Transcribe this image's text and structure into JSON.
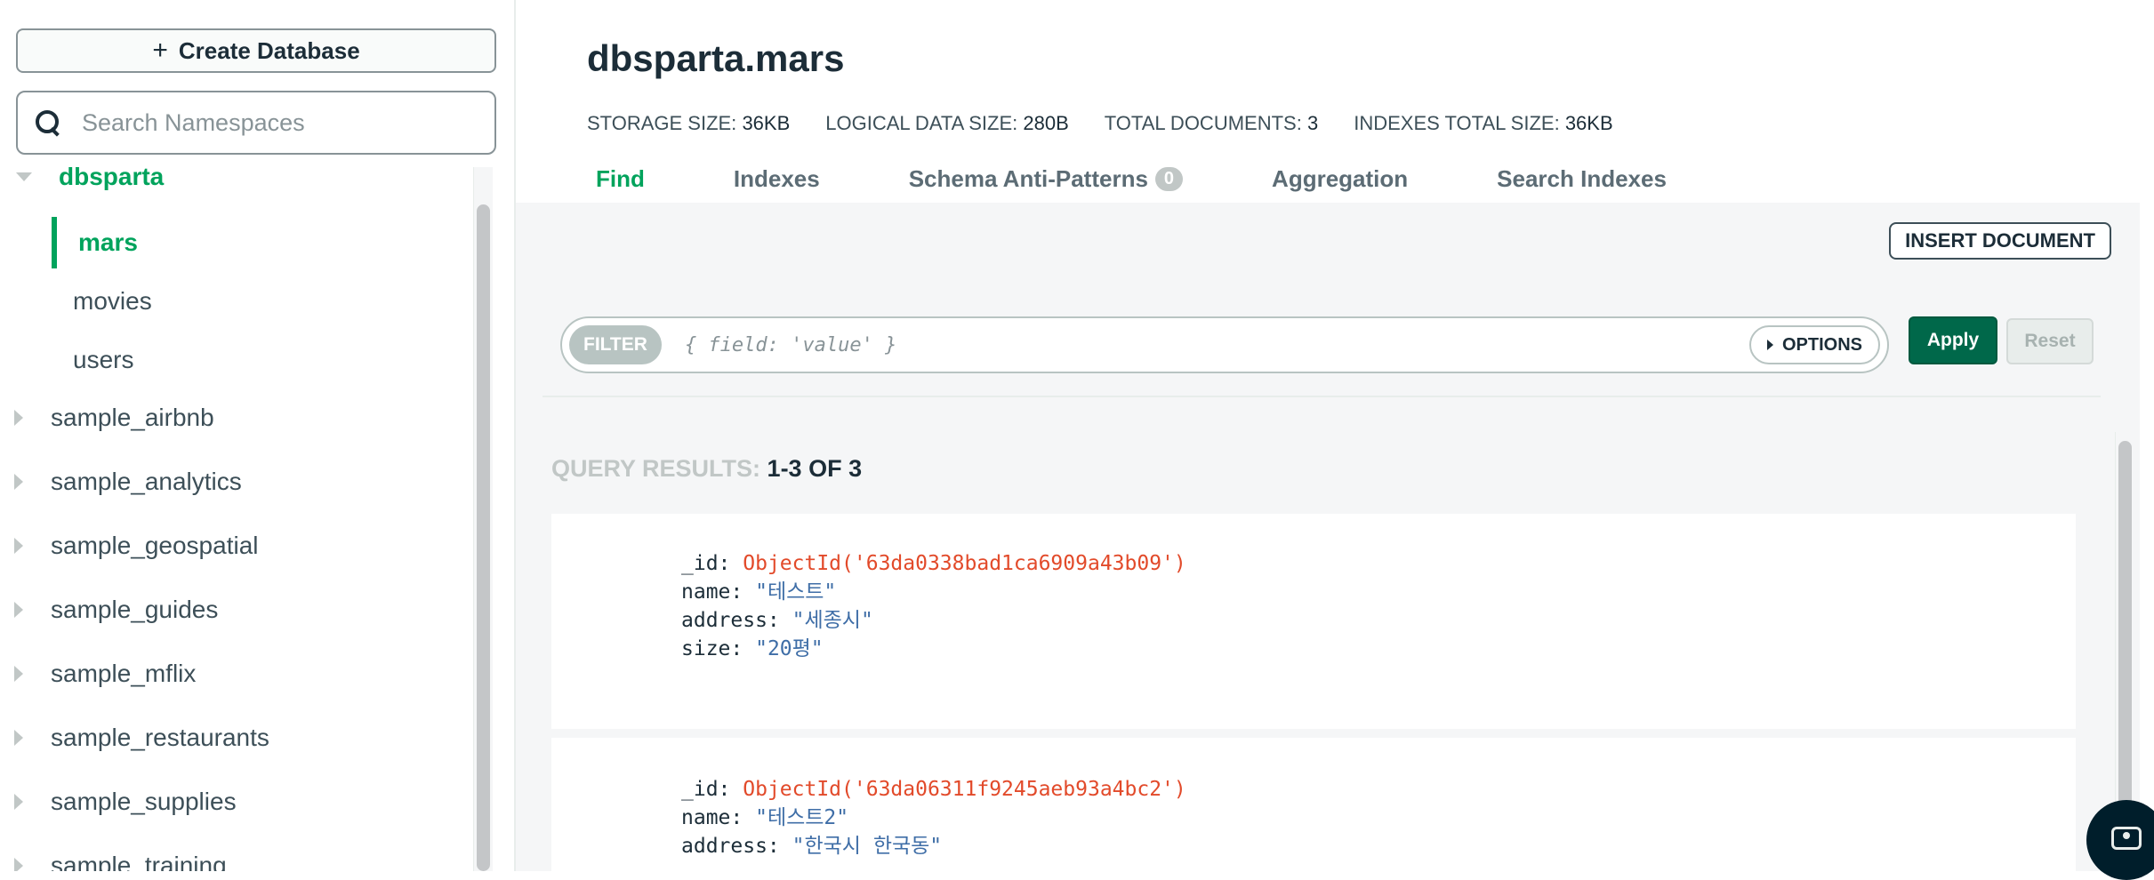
{
  "sidebar": {
    "create_database_label": "Create Database",
    "create_plus": "+",
    "search_placeholder": "Search Namespaces",
    "tree": [
      {
        "label": "dbsparta",
        "type": "database",
        "expanded": true,
        "active": true
      },
      {
        "label": "mars",
        "type": "collection",
        "active": true
      },
      {
        "label": "movies",
        "type": "collection"
      },
      {
        "label": "users",
        "type": "collection"
      },
      {
        "label": "sample_airbnb",
        "type": "database"
      },
      {
        "label": "sample_analytics",
        "type": "database"
      },
      {
        "label": "sample_geospatial",
        "type": "database"
      },
      {
        "label": "sample_guides",
        "type": "database"
      },
      {
        "label": "sample_mflix",
        "type": "database"
      },
      {
        "label": "sample_restaurants",
        "type": "database"
      },
      {
        "label": "sample_supplies",
        "type": "database"
      },
      {
        "label": "sample_training",
        "type": "database"
      }
    ]
  },
  "header": {
    "title": "dbsparta.mars",
    "stats": [
      {
        "key": "STORAGE SIZE:",
        "value": "36KB"
      },
      {
        "key": "LOGICAL DATA SIZE:",
        "value": "280B"
      },
      {
        "key": "TOTAL DOCUMENTS:",
        "value": "3"
      },
      {
        "key": "INDEXES TOTAL SIZE:",
        "value": "36KB"
      }
    ],
    "tabs": [
      {
        "label": "Find",
        "active": true
      },
      {
        "label": "Indexes"
      },
      {
        "label": "Schema Anti-Patterns",
        "badge": "0"
      },
      {
        "label": "Aggregation"
      },
      {
        "label": "Search Indexes"
      }
    ]
  },
  "toolbar": {
    "insert_document_label": "INSERT DOCUMENT",
    "filter_pill": "FILTER",
    "filter_placeholder": "{ field: 'value' }",
    "options_label": "OPTIONS",
    "apply_label": "Apply",
    "reset_label": "Reset"
  },
  "results": {
    "label": "QUERY RESULTS:",
    "count": "1-3 OF 3",
    "documents": [
      {
        "id_key": "_id:",
        "id_value": "ObjectId('63da0338bad1ca6909a43b09')",
        "name_key": "name:",
        "name_value": "\"테스트\"",
        "address_key": "address:",
        "address_value": "\"세종시\"",
        "size_key": "size:",
        "size_value": "\"20평\""
      },
      {
        "id_key": "_id:",
        "id_value": "ObjectId('63da06311f9245aeb93a4bc2')",
        "name_key": "name:",
        "name_value": "\"테스트2\"",
        "address_key": "address:",
        "address_value": "\"한국시 한국동\""
      }
    ]
  },
  "icons": {
    "search": "search-icon",
    "caret_right": "caret-right-icon",
    "caret_down": "caret-down-icon",
    "options_triangle": "triangle-right-icon",
    "chat": "chat-support-icon"
  },
  "colors": {
    "accent_green": "#00a35c",
    "apply_green": "#00684a",
    "object_id_red": "#e24a2a",
    "string_blue": "#3f6ea7"
  }
}
